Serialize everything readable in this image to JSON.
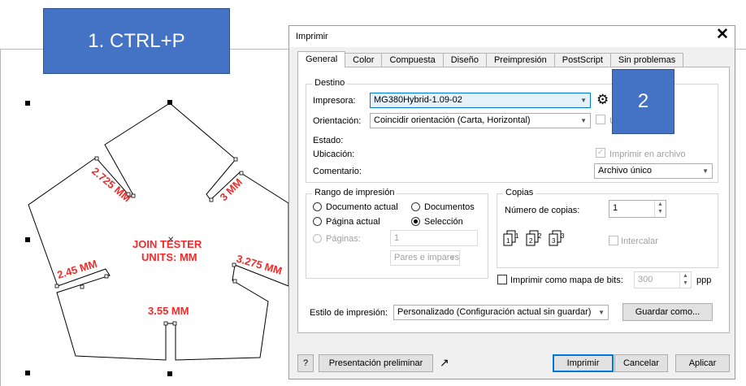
{
  "callouts": {
    "step1": "1. CTRL+P",
    "step2": "2"
  },
  "drawing": {
    "labels": {
      "a": "2.725 MM",
      "b": "3 MM",
      "c": "2.45 MM",
      "d": "3.275 MM",
      "e": "3.55 MM",
      "title_1": "JOIN TESTER",
      "title_2": "UNITS: MM"
    }
  },
  "dialog": {
    "title": "Imprimir",
    "close": "✕",
    "tabs": [
      "General",
      "Color",
      "Compuesta",
      "Diseño",
      "Preimpresión",
      "PostScript",
      "Sin problemas"
    ],
    "destino": {
      "title": "Destino",
      "printer_label": "Impresora:",
      "printer_value": "MG380Hybrid-1.09-02",
      "orientation_label": "Orientación:",
      "orientation_value": "Coincidir orientación (Carta, Horizontal)",
      "use_ppd": "U",
      "status_label": "Estado:",
      "location_label": "Ubicación:",
      "comment_label": "Comentario:",
      "print_to_file": "Imprimir en archivo",
      "file_mode": "Archivo único"
    },
    "range": {
      "title": "Rango de impresión",
      "current_doc": "Documento actual",
      "documents": "Documentos",
      "current_page": "Página actual",
      "selection": "Selección",
      "pages": "Páginas:",
      "pages_value": "1",
      "pages_filter": "Pares e impares"
    },
    "copies": {
      "title": "Copias",
      "count_label": "Número de copias:",
      "count_value": "1",
      "collate": "Intercalar"
    },
    "bitmap": {
      "label": "Imprimir como mapa de bits:",
      "dpi": "300",
      "unit": "ppp"
    },
    "style": {
      "label": "Estilo de impresión:",
      "value": "Personalizado (Configuración actual sin guardar)",
      "save_as": "Guardar como..."
    },
    "footer": {
      "help": "?",
      "preview": "Presentación preliminar",
      "print": "Imprimir",
      "cancel": "Cancelar",
      "apply": "Aplicar"
    }
  }
}
